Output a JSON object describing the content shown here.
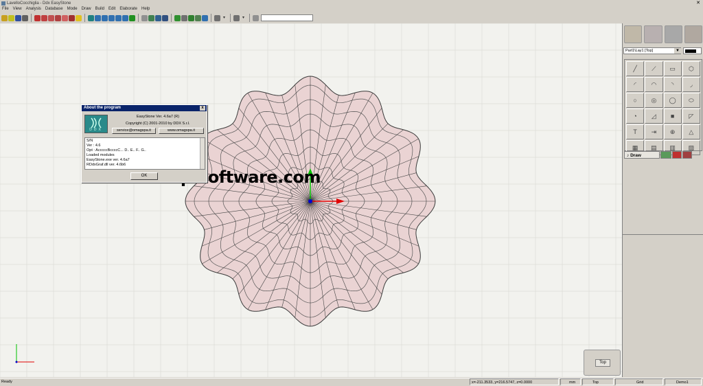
{
  "window": {
    "title": "LavelloCocchiglia - Ddx EasyStone",
    "close_glyph": "✕"
  },
  "menu": [
    "File",
    "View",
    "Analysis",
    "Database",
    "Mode",
    "Draw",
    "Build",
    "Edit",
    "Elaborate",
    "Help"
  ],
  "watermark": "vip-software.com",
  "about_dialog": {
    "title": "About the program",
    "close_glyph": "x",
    "logo_text": "DDX",
    "version": "EasyStone Ver. 4.6a7 (R)",
    "copyright": "Copyright (C) 2001-2010 by DDX S.r.l.",
    "email_button": "service@omagspa.it",
    "web_button": "www.omagspa.it",
    "info_lines": [
      "S/N",
      "Ver : 4.6",
      "Opt : AcccccBccccC... D.. E.. F.. G..",
      "Loaded modules",
      "   EasyStone.exe ver. 4.6a7",
      "   RDdxGraf.dll ver. 4.6b6"
    ],
    "ok_button": "OK"
  },
  "right_panel": {
    "layer_select": "Part1\\Lay1 [Top]",
    "layer_arrow": "▼",
    "draw_tab": "Draw",
    "draw_tab_glyph": "♪",
    "draw_tools": [
      "line-tool",
      "polyline-tool",
      "rectangle-tool",
      "polygon-tool",
      "arc-3p-tool",
      "arc-center-tool",
      "arc-tangent-tool",
      "arc-cs-tool",
      "circle-tool",
      "circle-center-tool",
      "circle-2p-tool",
      "ellipse-tool",
      "fillet-tool",
      "chamfer-tool",
      "color-tool",
      "dimension-tool",
      "text-tool",
      "offset-tool",
      "intersection-tool",
      "triangle-tool",
      "surface-tool",
      "extrude-tool",
      "emboss-tool",
      "revolve-tool"
    ]
  },
  "view_nav": {
    "view_button": "Top"
  },
  "statusbar": {
    "ready": "Ready",
    "coords": "x=-211.3533, y=216.5747, z=0.0000",
    "unit": "mm",
    "view": "Top",
    "grid": "Grid",
    "mode": "Demo1"
  },
  "colors": {
    "model_fill": "#ead3d3",
    "model_stroke": "#3a3a3a",
    "grid": "#dcdcd6",
    "viewport_bg": "#f2f2ee",
    "dialog_title": "#0a246a",
    "axis_x": "#e00000",
    "axis_y": "#00c000",
    "axis_origin": "#0000cc"
  }
}
